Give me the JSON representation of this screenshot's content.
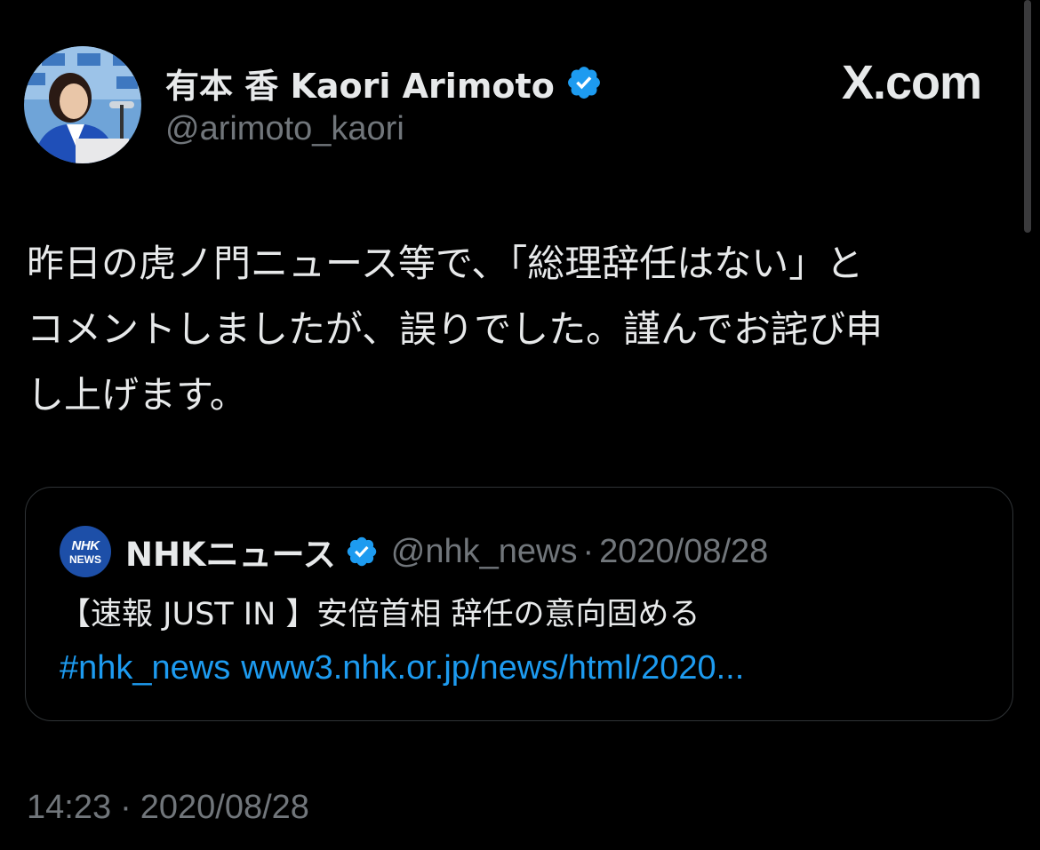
{
  "brand": {
    "label": "X.com"
  },
  "author": {
    "display_name": "有本 香  Kaori Arimoto",
    "handle": "@arimoto_kaori",
    "verified": true,
    "avatar_icon": "user-avatar-photo"
  },
  "tweet": {
    "lines": [
      "昨日の虎ノ門ニュース等で、「総理辞任はない」と",
      "コメントしましたが、誤りでした。謹んでお詫び申",
      "し上げます。"
    ],
    "time": "14:23",
    "separator": "·",
    "date": "2020/08/28"
  },
  "quoted_tweet": {
    "logo_line1": "NHK",
    "logo_line2": "NEWS",
    "display_name": "NHKニュース",
    "verified": true,
    "handle": "@nhk_news",
    "separator": "·",
    "date": "2020/08/28",
    "text": "【速報 JUST IN 】安倍首相 辞任の意向固める",
    "hashtag": "#nhk_news",
    "link": "www3.nhk.or.jp/news/html/2020..."
  },
  "colors": {
    "background": "#000000",
    "text": "#e7e9ea",
    "secondary_text": "#71767b",
    "link": "#1d9bf0",
    "verified_badge": "#1d9bf0",
    "card_border": "#2f3336"
  }
}
